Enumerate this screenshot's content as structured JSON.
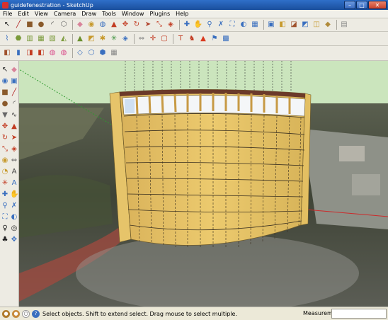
{
  "window": {
    "title": "guidefenestration - SketchUp",
    "minimize_glyph": "–",
    "maximize_glyph": "□",
    "close_glyph": "✕"
  },
  "menu": [
    "File",
    "Edit",
    "View",
    "Camera",
    "Draw",
    "Tools",
    "Window",
    "Plugins",
    "Help"
  ],
  "toolbar_row1": [
    {
      "name": "select-icon",
      "glyph": "↖",
      "color": "#222222"
    },
    {
      "name": "pencil-icon",
      "glyph": "╱",
      "color": "#b01c1c"
    },
    {
      "name": "rectangle-icon",
      "glyph": "■",
      "color": "#8a5a2b"
    },
    {
      "name": "circle-icon",
      "glyph": "●",
      "color": "#8a5a2b"
    },
    {
      "name": "arc-icon",
      "glyph": "◜",
      "color": "#444444"
    },
    {
      "name": "polygon-icon",
      "glyph": "⬡",
      "color": "#666666"
    },
    {
      "name": "eraser-icon",
      "glyph": "◆",
      "color": "#d9839a"
    },
    {
      "name": "tape-measure-icon",
      "glyph": "◉",
      "color": "#c79a2e"
    },
    {
      "name": "paint-bucket-icon",
      "glyph": "◍",
      "color": "#3a6fbf"
    },
    {
      "name": "push-pull-icon",
      "glyph": "▲",
      "color": "#c23b22"
    },
    {
      "name": "move-icon",
      "glyph": "✥",
      "color": "#c23b22"
    },
    {
      "name": "rotate-icon",
      "glyph": "↻",
      "color": "#c23b22"
    },
    {
      "name": "follow-me-icon",
      "glyph": "➤",
      "color": "#b0412a"
    },
    {
      "name": "scale-icon",
      "glyph": "⤡",
      "color": "#c23b22"
    },
    {
      "name": "offset-icon",
      "glyph": "◈",
      "color": "#c23b22"
    },
    {
      "name": "orbit-icon",
      "glyph": "✚",
      "color": "#3a6fbf"
    },
    {
      "name": "pan-icon",
      "glyph": "✋",
      "color": "#3a6fbf"
    },
    {
      "name": "zoom-icon",
      "glyph": "⚲",
      "color": "#3a6fbf"
    },
    {
      "name": "zoom-window-icon",
      "glyph": "✗",
      "color": "#3a6fbf"
    },
    {
      "name": "zoom-extents-icon",
      "glyph": "⛶",
      "color": "#3a6fbf"
    },
    {
      "name": "previous-view-icon",
      "glyph": "◐",
      "color": "#3a6fbf"
    },
    {
      "name": "get-models-icon",
      "glyph": "▦",
      "color": "#3a6fbf"
    },
    {
      "name": "share-model-icon",
      "glyph": "▣",
      "color": "#3a6fbf"
    },
    {
      "name": "components-icon",
      "glyph": "◧",
      "color": "#c79a2e"
    },
    {
      "name": "materials-icon",
      "glyph": "◪",
      "color": "#a0522d"
    },
    {
      "name": "styles-icon",
      "glyph": "◩",
      "color": "#3a6fbf"
    },
    {
      "name": "layers-icon",
      "glyph": "◫",
      "color": "#c79a2e"
    },
    {
      "name": "extension-icon",
      "glyph": "◆",
      "color": "#b08a3a"
    },
    {
      "name": "preview-icon",
      "glyph": "▤",
      "color": "#888888"
    }
  ],
  "toolbar_row2": [
    {
      "name": "sandbox-smoove-icon",
      "glyph": "⌇",
      "color": "#3a6fbf"
    },
    {
      "name": "sandbox-stamp-icon",
      "glyph": "⬣",
      "color": "#7a9a3a"
    },
    {
      "name": "sandbox-drape-icon",
      "glyph": "▥",
      "color": "#7a9a3a"
    },
    {
      "name": "sandbox-grid-icon",
      "glyph": "▦",
      "color": "#7a9a3a"
    },
    {
      "name": "sandbox-detail-icon",
      "glyph": "▧",
      "color": "#7a9a3a"
    },
    {
      "name": "sandbox-flip-icon",
      "glyph": "◭",
      "color": "#7a9a3a"
    },
    {
      "name": "terrain-icon",
      "glyph": "▲",
      "color": "#6a8f2e"
    },
    {
      "name": "section-plane-icon",
      "glyph": "◩",
      "color": "#c79a2e"
    },
    {
      "name": "section-cut-icon",
      "glyph": "✱",
      "color": "#c79a2e"
    },
    {
      "name": "section-display-icon",
      "glyph": "✳",
      "color": "#3a8f3a"
    },
    {
      "name": "texture-icon",
      "glyph": "◈",
      "color": "#3a6fbf"
    },
    {
      "name": "dimension-icon",
      "glyph": "⇔",
      "color": "#888888"
    },
    {
      "name": "axes-icon",
      "glyph": "✛",
      "color": "#c23b22"
    },
    {
      "name": "group-icon",
      "glyph": "▢",
      "color": "#c23b22"
    },
    {
      "name": "text-icon",
      "glyph": "T",
      "color": "#c23b22"
    },
    {
      "name": "walk-icon",
      "glyph": "♞",
      "color": "#c23b22"
    },
    {
      "name": "warning-icon",
      "glyph": "▲",
      "color": "#d93a1f"
    },
    {
      "name": "geo-location-icon",
      "glyph": "⚑",
      "color": "#3a6fbf"
    },
    {
      "name": "photo-texture-icon",
      "glyph": "▩",
      "color": "#3a6fbf"
    }
  ],
  "toolbar_row3": [
    {
      "name": "iso-view-icon",
      "glyph": "◧",
      "color": "#a0522d"
    },
    {
      "name": "top-view-icon",
      "glyph": "▮",
      "color": "#3a6fbf"
    },
    {
      "name": "front-view-icon",
      "glyph": "◨",
      "color": "#c23b22"
    },
    {
      "name": "right-view-icon",
      "glyph": "◧",
      "color": "#c23b22"
    },
    {
      "name": "back-view-icon",
      "glyph": "◍",
      "color": "#d94a8a"
    },
    {
      "name": "left-view-icon",
      "glyph": "◍",
      "color": "#d94a8a"
    },
    {
      "name": "xray-icon",
      "glyph": "◇",
      "color": "#3a6fbf"
    },
    {
      "name": "wireframe-icon",
      "glyph": "⬡",
      "color": "#3a6fbf"
    },
    {
      "name": "hidden-line-icon",
      "glyph": "⬢",
      "color": "#3a6fbf"
    },
    {
      "name": "shaded-icon",
      "glyph": "▦",
      "color": "#888888"
    }
  ],
  "palette": [
    {
      "name": "select-tool-icon",
      "glyph": "↖",
      "color": "#222222"
    },
    {
      "name": "eraser-tool-icon",
      "glyph": "◆",
      "color": "#d9839a"
    },
    {
      "name": "paint-tool-icon",
      "glyph": "◉",
      "color": "#3a6fbf"
    },
    {
      "name": "make-component-icon",
      "glyph": "▣",
      "color": "#3a6fbf"
    },
    {
      "name": "rectangle-tool-icon",
      "glyph": "■",
      "color": "#8a5a2b"
    },
    {
      "name": "line-tool-icon",
      "glyph": "╱",
      "color": "#b01c1c"
    },
    {
      "name": "circle-tool-icon",
      "glyph": "●",
      "color": "#8a5a2b"
    },
    {
      "name": "arc-tool-icon",
      "glyph": "◜",
      "color": "#444444"
    },
    {
      "name": "polygon-tool-icon",
      "glyph": "▼",
      "color": "#666666"
    },
    {
      "name": "freehand-tool-icon",
      "glyph": "∿",
      "color": "#444444"
    },
    {
      "name": "move-tool-icon",
      "glyph": "✥",
      "color": "#c23b22"
    },
    {
      "name": "push-pull-tool-icon",
      "glyph": "▲",
      "color": "#c23b22"
    },
    {
      "name": "rotate-tool-icon",
      "glyph": "↻",
      "color": "#c23b22"
    },
    {
      "name": "follow-me-tool-icon",
      "glyph": "➤",
      "color": "#c23b22"
    },
    {
      "name": "scale-tool-icon",
      "glyph": "⤡",
      "color": "#c23b22"
    },
    {
      "name": "offset-tool-icon",
      "glyph": "◈",
      "color": "#c23b22"
    },
    {
      "name": "tape-tool-icon",
      "glyph": "◉",
      "color": "#c79a2e"
    },
    {
      "name": "dimension-tool-icon",
      "glyph": "⇔",
      "color": "#666666"
    },
    {
      "name": "protractor-tool-icon",
      "glyph": "◔",
      "color": "#c79a2e"
    },
    {
      "name": "text-tool-icon",
      "glyph": "A",
      "color": "#444444"
    },
    {
      "name": "axes-tool-icon",
      "glyph": "✳",
      "color": "#c23b22"
    },
    {
      "name": "3d-text-tool-icon",
      "glyph": "A",
      "color": "#3a6fbf"
    },
    {
      "name": "orbit-tool-icon",
      "glyph": "✚",
      "color": "#3a6fbf"
    },
    {
      "name": "pan-tool-icon",
      "glyph": "✋",
      "color": "#3a6fbf"
    },
    {
      "name": "zoom-tool-icon",
      "glyph": "⚲",
      "color": "#3a6fbf"
    },
    {
      "name": "zoom-window-tool-icon",
      "glyph": "✗",
      "color": "#3a6fbf"
    },
    {
      "name": "zoom-extents-tool-icon",
      "glyph": "⛶",
      "color": "#3a6fbf"
    },
    {
      "name": "previous-tool-icon",
      "glyph": "◐",
      "color": "#3a6fbf"
    },
    {
      "name": "position-camera-tool-icon",
      "glyph": "♀",
      "color": "#222222"
    },
    {
      "name": "look-around-tool-icon",
      "glyph": "◎",
      "color": "#222222"
    },
    {
      "name": "walk-tool-icon",
      "glyph": "♣",
      "color": "#222222"
    },
    {
      "name": "section-tool-icon",
      "glyph": "✥",
      "color": "#3a6fbf"
    }
  ],
  "status": {
    "geo_icon": "geo-location-icon",
    "credits_icon": "credits-icon",
    "user_icon": "user-icon",
    "help_icon": "help-icon",
    "message": "Select objects. Shift to extend select. Drag mouse to select multiple.",
    "measurements_label": "Measurements",
    "measurements_value": ""
  },
  "colors": {
    "sky": "#cbe5bd",
    "building_facade": "#e9c86a",
    "building_side": "#f0d27e",
    "roof_band": "#6b3a2a",
    "window_glass": "#f4f6f8",
    "axis_red": "#cc2a2a",
    "axis_green": "#2e9a2e"
  }
}
